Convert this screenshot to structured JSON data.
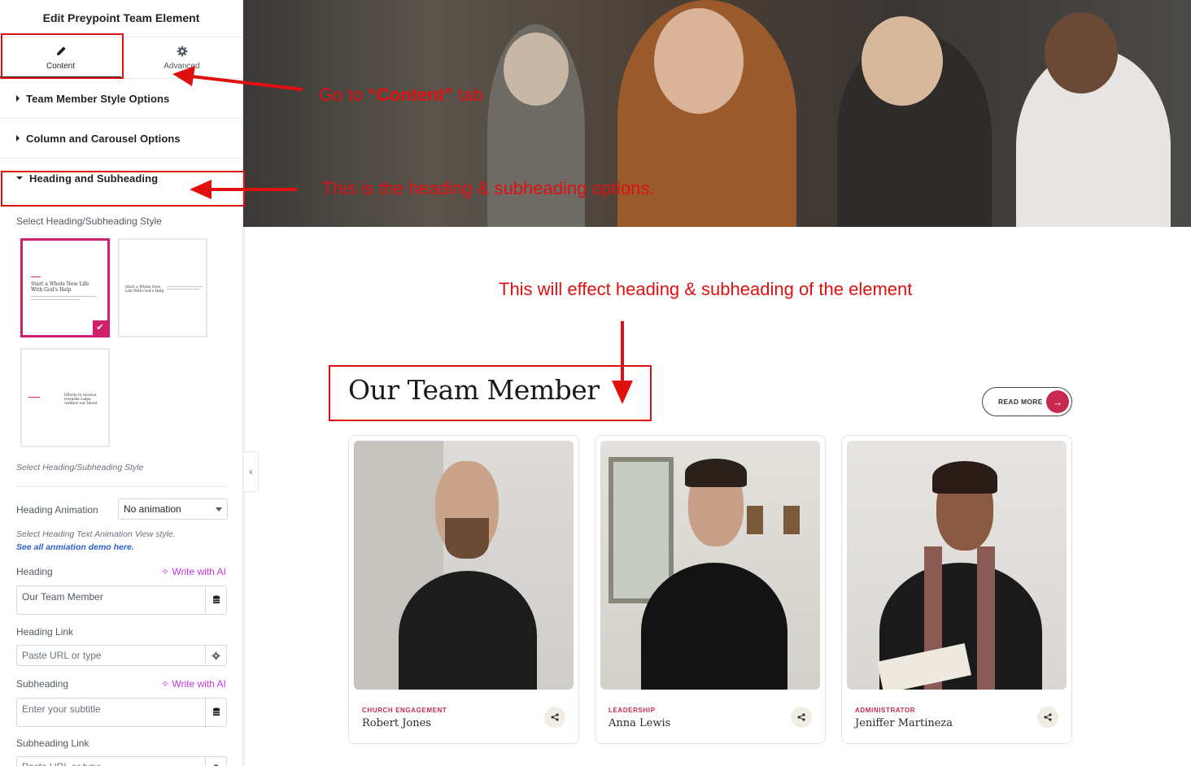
{
  "panel": {
    "title": "Edit Preypoint Team Element",
    "tabs": [
      {
        "label": "Content",
        "icon": "pencil-icon",
        "active": true
      },
      {
        "label": "Advanced",
        "icon": "gear-icon",
        "active": false
      }
    ],
    "sections": [
      {
        "label": "Team Member Style Options",
        "open": false
      },
      {
        "label": "Column and Carousel Options",
        "open": false
      },
      {
        "label": "Heading and Subheading",
        "open": true
      }
    ],
    "style_select_label": "Select Heading/Subheading Style",
    "style_thumbs": {
      "thumb1_title": "Start a Whole New Life With God's Help",
      "thumb2_title": "Start a Whole New Life With God's Help",
      "thumb3_title": "Efforts to receive rewards Lalpo welfare our tmost"
    },
    "style_hint": "Select Heading/Subheading Style",
    "heading_animation": {
      "label": "Heading Animation",
      "value": "No animation"
    },
    "animation_hint": "Select Heading Text Animation View style.",
    "animation_link": "See all anmiation demo here.",
    "heading": {
      "label": "Heading",
      "ai_label": "Write with AI",
      "value": "Our Team Member"
    },
    "heading_link": {
      "label": "Heading Link",
      "placeholder": "Paste URL or type"
    },
    "subheading": {
      "label": "Subheading",
      "ai_label": "Write with AI",
      "placeholder": "Enter your subtitle"
    },
    "subheading_link": {
      "label": "Subheading Link",
      "placeholder": "Paste URL or type"
    }
  },
  "preview": {
    "heading": "Our Team Member",
    "read_more": "READ MORE",
    "members": [
      {
        "role": "CHURCH ENGAGEMENT",
        "name": "Robert Jones"
      },
      {
        "role": "LEADERSHIP",
        "name": "Anna Lewis"
      },
      {
        "role": "ADMINISTRATOR",
        "name": "Jeniffer Martineza"
      }
    ]
  },
  "annotations": {
    "content_tab_pre": "Go  to ",
    "content_tab_bold": "“Content”",
    "content_tab_post": " tab",
    "heading_options": "This is the heading & subheading options.",
    "effect": "This will effect heading & subheading of the element"
  },
  "colors": {
    "accent": "#d01f6d",
    "annotation": "#e01010",
    "brand_red": "#c62a4e",
    "link": "#2d60c9",
    "ai": "#c036d9"
  }
}
